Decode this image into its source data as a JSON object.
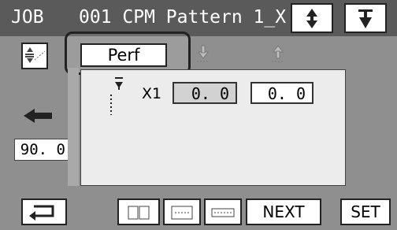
{
  "header": {
    "job_label": "JOB",
    "pattern_title": "001 CPM Pattern 1_X"
  },
  "tabs": {
    "perf_label": "Perf"
  },
  "panel": {
    "axis_label": "X1",
    "value_gray": "0. 0",
    "value_white": "0. 0"
  },
  "left": {
    "position_value": "90. 0"
  },
  "footer": {
    "next_label": "NEXT",
    "set_label": "SET"
  },
  "icons": {
    "up_down_icon": "up-down-arrow-icon",
    "down_icon": "down-arrow-icon",
    "back_icon": "return-icon"
  }
}
